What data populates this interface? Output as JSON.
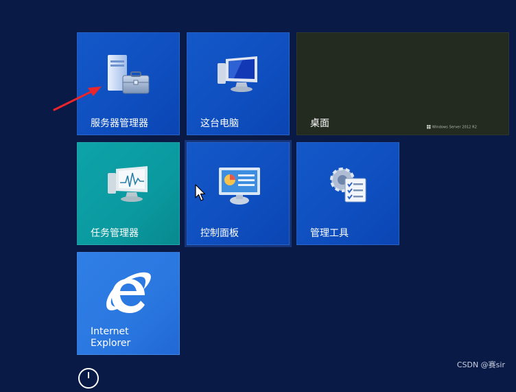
{
  "tiles": [
    {
      "id": "server-manager",
      "label": "服务器管理器"
    },
    {
      "id": "this-pc",
      "label": "这台电脑"
    },
    {
      "id": "desktop",
      "label": "桌面",
      "watermark": "Windows Server 2012 R2"
    },
    {
      "id": "task-manager",
      "label": "任务管理器"
    },
    {
      "id": "control-panel",
      "label": "控制面板"
    },
    {
      "id": "admin-tools",
      "label": "管理工具"
    },
    {
      "id": "internet-explorer",
      "label_line1": "Internet",
      "label_line2": "Explorer"
    }
  ],
  "icons": {
    "server_manager": "server-toolbox-icon",
    "this_pc": "computer-monitor-icon",
    "task_manager": "activity-monitor-icon",
    "control_panel": "control-panel-icon",
    "admin_tools": "gears-checklist-icon",
    "internet_explorer": "internet-explorer-icon",
    "power": "power-icon"
  },
  "colors": {
    "background": "#0a1a47",
    "tile_blue": "#0f4fc0",
    "tile_teal": "#0a9aa0",
    "tile_desktop": "#232a20",
    "tile_ie": "#2a77e0",
    "annotation_arrow": "#e8262b"
  },
  "watermark": "CSDN @赛sir"
}
